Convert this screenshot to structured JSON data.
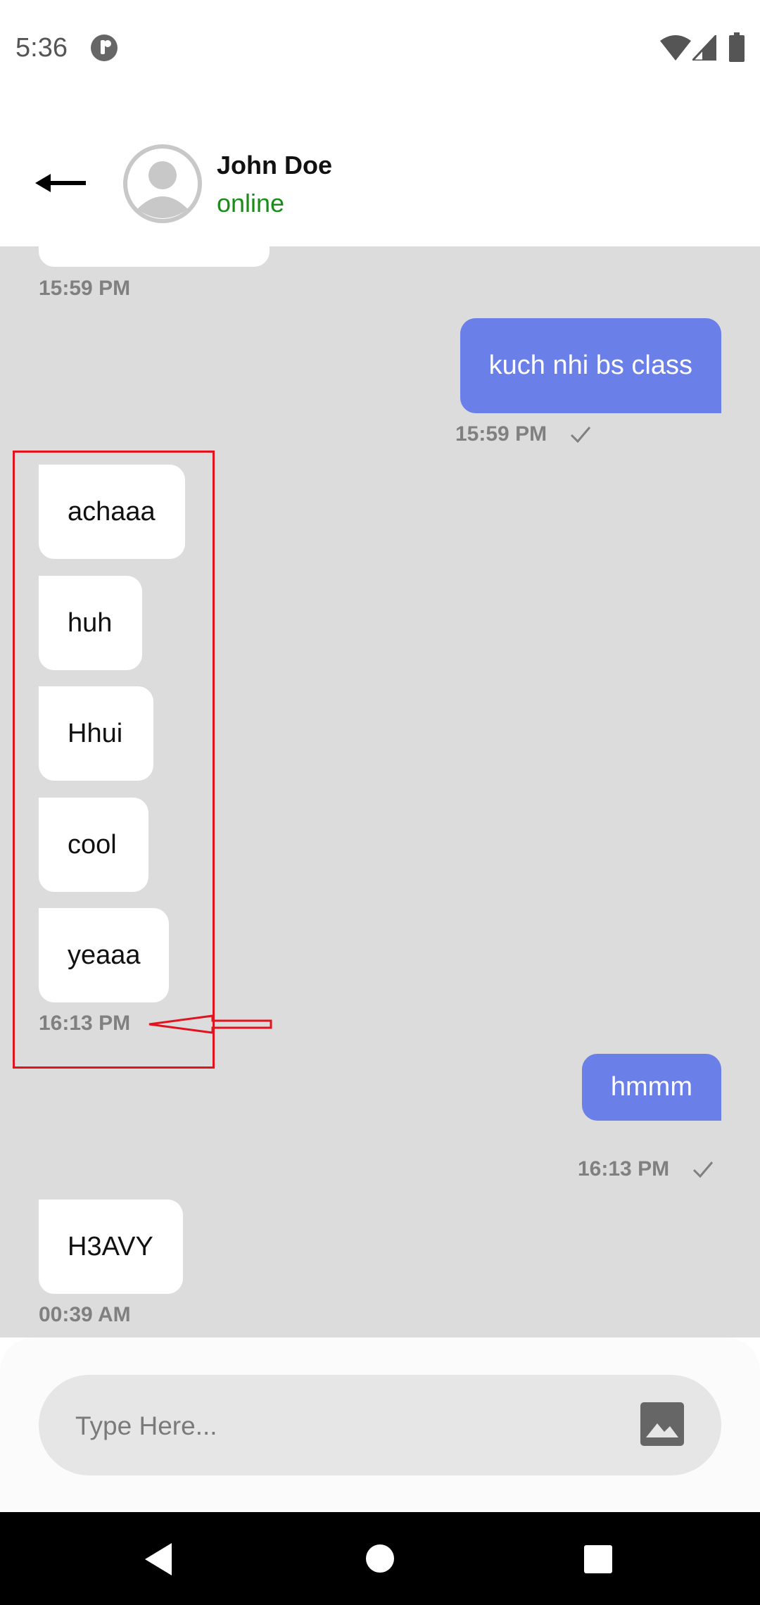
{
  "status_bar": {
    "time": "5:36",
    "icons": [
      "app-indicator-icon",
      "wifi-icon",
      "signal-icon",
      "battery-icon"
    ]
  },
  "header": {
    "back_icon": "arrow-left-icon",
    "avatar_icon": "default-avatar-icon",
    "contact_name": "John Doe",
    "contact_status": "online"
  },
  "messages": [
    {
      "direction": "incoming",
      "time": "15:59 PM"
    },
    {
      "direction": "outgoing",
      "text": "kuch nhi bs class",
      "time": "15:59 PM",
      "status_icon": "check-icon"
    },
    {
      "direction": "incoming",
      "text": "achaaa"
    },
    {
      "direction": "incoming",
      "text": "huh"
    },
    {
      "direction": "incoming",
      "text": "Hhui"
    },
    {
      "direction": "incoming",
      "text": "cool"
    },
    {
      "direction": "incoming",
      "text": "yeaaa",
      "time": "16:13 PM"
    },
    {
      "direction": "outgoing",
      "text": "hmmm",
      "time": "16:13 PM",
      "status_icon": "check-icon"
    },
    {
      "direction": "incoming",
      "text": "H3AVY",
      "time": "00:39 AM"
    }
  ],
  "composer": {
    "placeholder": "Type Here...",
    "attach_icon": "image-icon"
  },
  "nav_bar": {
    "icons": [
      "nav-back-icon",
      "nav-home-icon",
      "nav-recents-icon"
    ]
  },
  "colors": {
    "outgoing_bubble": "#6b7fe8",
    "incoming_bubble": "#ffffff",
    "chat_background": "#dcdcdc",
    "online_status": "#1a8c1a",
    "annotation": "#e0141e"
  }
}
